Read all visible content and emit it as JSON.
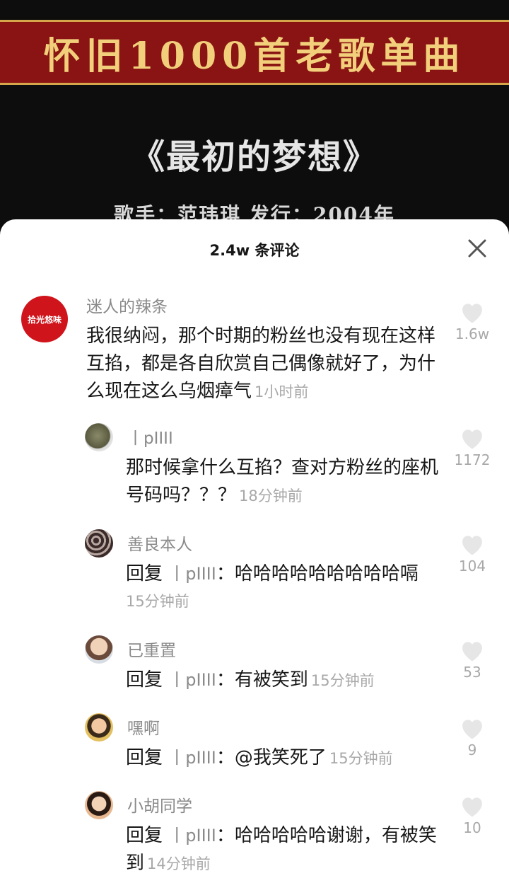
{
  "video": {
    "banner_text": "怀旧1000首老歌单曲",
    "song_title": "《最初的梦想》",
    "song_meta": "歌手：范玮琪 发行：2004年"
  },
  "sheet": {
    "title": "2.4w 条评论",
    "close_icon": "close-icon",
    "like_icon": "heart-icon"
  },
  "comments": [
    {
      "user": "迷人的辣条",
      "avatar_text": "拾光悠味",
      "text": "我很纳闷，那个时期的粉丝也没有现在这样互掐，都是各自欣赏自己偶像就好了，为什么现在这么乌烟瘴气",
      "time": "1小时前",
      "likes": "1.6w"
    },
    {
      "user": "丨pIIII",
      "text": "那时候拿什么互掐？查对方粉丝的座机号码吗？？？",
      "time": "18分钟前",
      "likes": "1172"
    },
    {
      "user": "善良本人",
      "reply_prefix": "回复",
      "reply_to": "丨pIIII",
      "reply_colon": "：",
      "text": "哈哈哈哈哈哈哈哈哈嗝",
      "time": "15分钟前",
      "likes": "104"
    },
    {
      "user": "已重置",
      "reply_prefix": "回复",
      "reply_to": "丨pIIII",
      "reply_colon": "：",
      "text": "有被笑到",
      "time": "15分钟前",
      "likes": "53"
    },
    {
      "user": "嘿啊",
      "reply_prefix": "回复",
      "reply_to": "丨pIIII",
      "reply_colon": "：",
      "text": "@我笑死了",
      "time": "15分钟前",
      "likes": "9"
    },
    {
      "user": "小胡同学",
      "reply_prefix": "回复",
      "reply_to": "丨pIIII",
      "reply_colon": "：",
      "text": "哈哈哈哈哈谢谢，有被笑到",
      "time": "14分钟前",
      "likes": "10"
    }
  ]
}
